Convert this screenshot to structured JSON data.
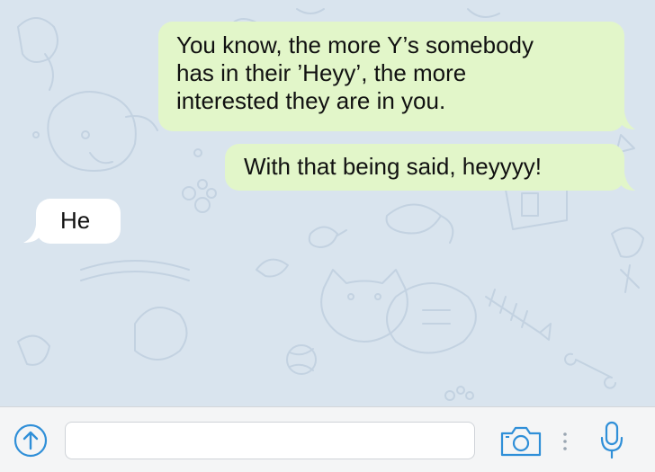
{
  "messages": [
    {
      "direction": "outgoing",
      "lines": [
        "You know, the more Y’s somebody",
        "has in their ’Heyy’, the more",
        "interested they are in you."
      ]
    },
    {
      "direction": "outgoing",
      "lines": [
        "With that being said, heyyyy!"
      ]
    },
    {
      "direction": "incoming",
      "lines": [
        "He"
      ]
    }
  ],
  "composer": {
    "message_value": "",
    "attach_icon": "arrow-up-circle-icon",
    "camera_icon": "camera-icon",
    "more_icon": "vertical-dots-icon",
    "mic_icon": "microphone-icon"
  },
  "colors": {
    "outgoing_bubble": "#e2f6c9",
    "incoming_bubble": "#ffffff",
    "accent": "#2f8fd8",
    "wallpaper": "#d9e4ee"
  }
}
